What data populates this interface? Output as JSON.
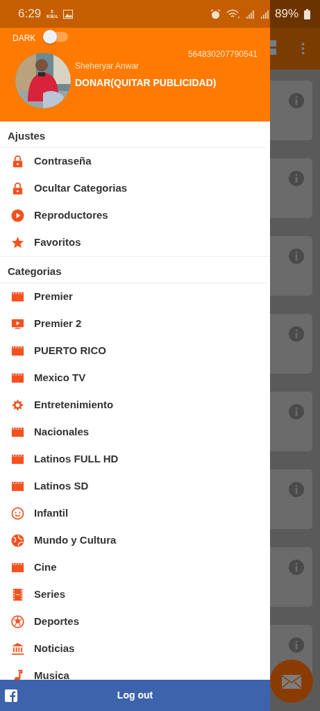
{
  "status_bar": {
    "time": "6:29",
    "net_speed": "0",
    "net_unit": "KB/s",
    "battery": "89%"
  },
  "drawer_header": {
    "dark_label": "DARK",
    "dark_on": false,
    "user_id": "564830207790541",
    "user_name": "Sheheryar Anwar",
    "donate": "DONAR(QUITAR PUBLICIDAD)"
  },
  "sections": [
    {
      "title": "Ajustes",
      "items": [
        {
          "label": "Contraseña"
        },
        {
          "label": "Ocultar Categorias"
        },
        {
          "label": "Reproductores"
        },
        {
          "label": "Favoritos"
        }
      ]
    },
    {
      "title": "Categorias",
      "items": [
        {
          "label": "Premier"
        },
        {
          "label": "Premier 2"
        },
        {
          "label": "PUERTO RICO"
        },
        {
          "label": "Mexico TV"
        },
        {
          "label": "Entretenimiento"
        },
        {
          "label": "Nacionales"
        },
        {
          "label": "Latinos FULL HD"
        },
        {
          "label": "Latinos SD"
        },
        {
          "label": "Infantil"
        },
        {
          "label": "Mundo y Cultura"
        },
        {
          "label": "Cine"
        },
        {
          "label": "Series"
        },
        {
          "label": "Deportes"
        },
        {
          "label": "Noticias"
        },
        {
          "label": "Musica"
        }
      ]
    }
  ],
  "logout": {
    "label": "Log out"
  }
}
